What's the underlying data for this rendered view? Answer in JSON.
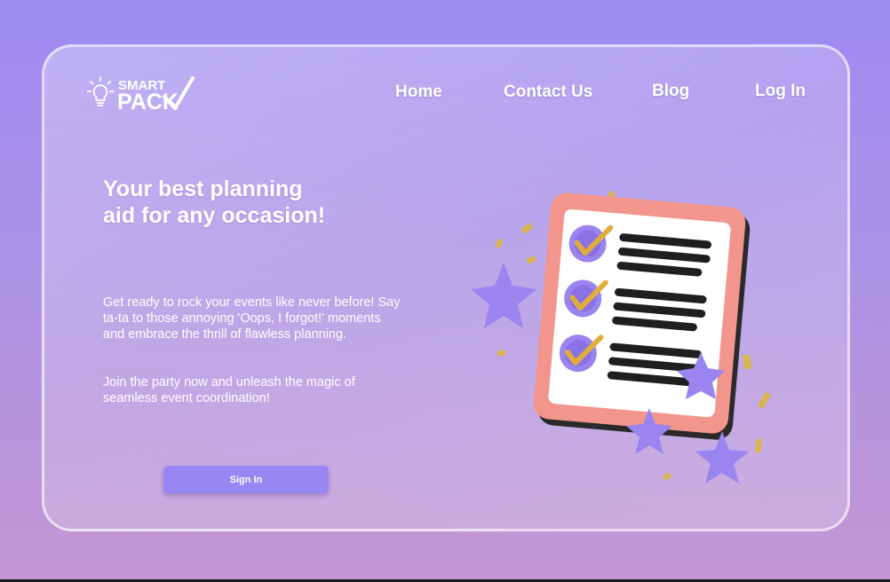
{
  "brand": {
    "line1": "SMART",
    "line2": "PACK",
    "icons": [
      "lightbulb-icon",
      "checkmark-swoosh-icon"
    ]
  },
  "nav": {
    "home": "Home",
    "contact": "Contact Us",
    "blog": "Blog",
    "login": "Log In"
  },
  "hero": {
    "headline": "Your best planning aid for any occasion!",
    "paragraph1": "Get ready to rock your events like never before! Say ta-ta to those annoying 'Oops, I forgot!' moments and embrace the thrill of flawless planning.",
    "paragraph2": "Join the party now and unleash the magic of seamless event coordination!",
    "cta": "Sign In"
  },
  "illustration": {
    "icons": [
      "clipboard-checklist-icon",
      "star-icon",
      "checkmark-icon",
      "confetti-icon"
    ]
  },
  "colors": {
    "bg_top": "#9d8bf2",
    "bg_bottom": "#c396d3",
    "button": "#9887f3",
    "clipboard": "#f2958c",
    "star": "#9a84f0",
    "check": "#e1ac3e",
    "confetti": "#d8b54d"
  }
}
